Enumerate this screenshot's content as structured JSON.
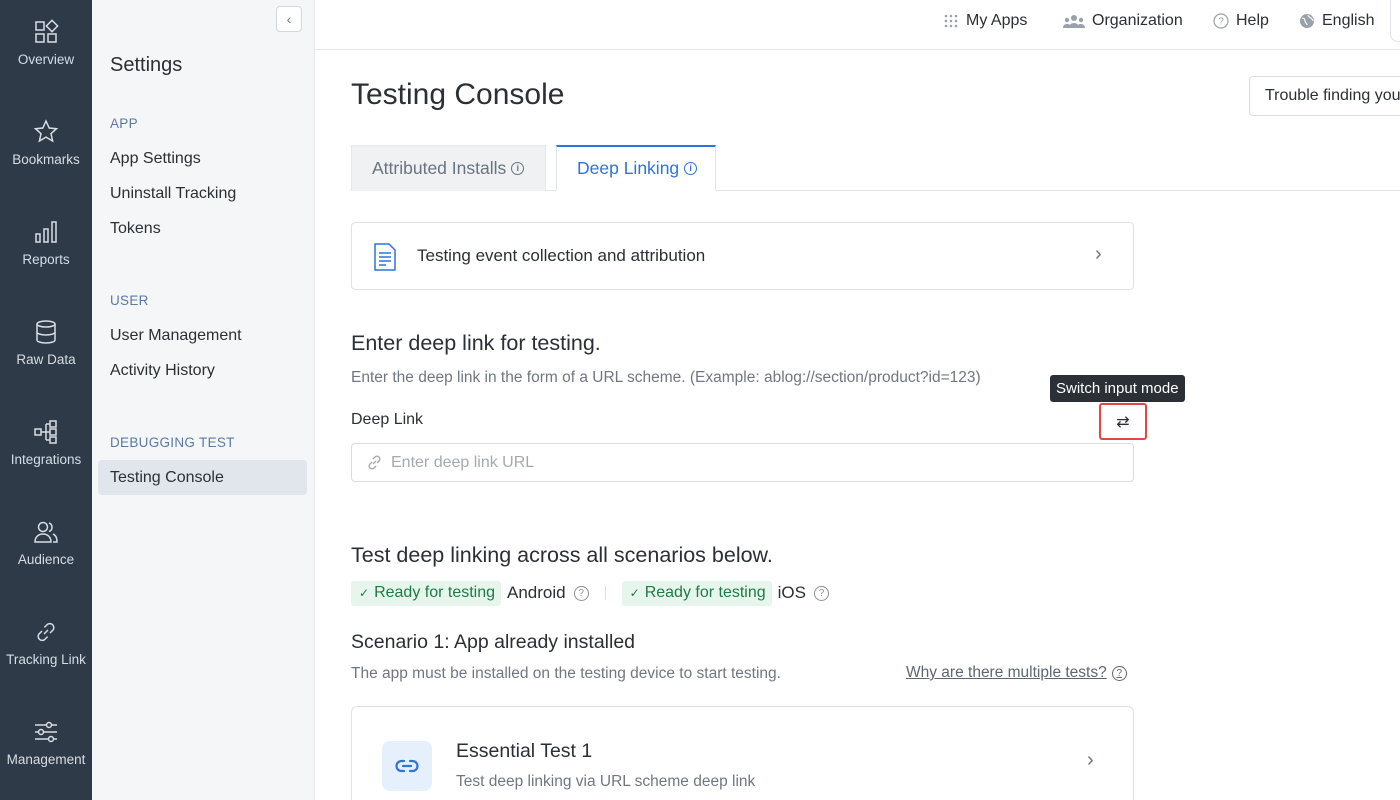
{
  "rail": {
    "items": [
      {
        "label": "Overview",
        "icon": "overview-grid-icon"
      },
      {
        "label": "Bookmarks",
        "icon": "star-icon"
      },
      {
        "label": "Reports",
        "icon": "bar-chart-icon"
      },
      {
        "label": "Raw Data",
        "icon": "database-icon"
      },
      {
        "label": "Integrations",
        "icon": "integration-tree-icon"
      },
      {
        "label": "Audience",
        "icon": "users-icon"
      },
      {
        "label": "Tracking Link",
        "icon": "link-icon"
      },
      {
        "label": "Management",
        "icon": "sliders-icon"
      }
    ]
  },
  "sidebar": {
    "collapse_glyph": "‹",
    "title": "Settings",
    "sections": [
      {
        "label": "APP",
        "items": [
          "App Settings",
          "Uninstall Tracking",
          "Tokens"
        ]
      },
      {
        "label": "USER",
        "items": [
          "User Management",
          "Activity History"
        ]
      },
      {
        "label": "DEBUGGING TEST",
        "items": [
          "Testing Console"
        ]
      }
    ],
    "active_item": "Testing Console"
  },
  "topbar": {
    "my_apps": "My Apps",
    "organization": "Organization",
    "help": "Help",
    "language": "English"
  },
  "main": {
    "title": "Testing Console",
    "trouble_button": "Trouble finding you",
    "tabs": [
      {
        "label": "Attributed Installs",
        "active": false
      },
      {
        "label": "Deep Linking",
        "active": true
      }
    ],
    "guide_card": "Testing event collection and attribution",
    "deep_link": {
      "heading": "Enter deep link for testing.",
      "description": "Enter the deep link in the form of a URL scheme. (Example: ablog://section/product?id=123)",
      "field_label": "Deep Link",
      "placeholder": "Enter deep link URL",
      "value": "",
      "tooltip": "Switch input mode",
      "switch_glyph": "⇄"
    },
    "scenarios": {
      "heading": "Test deep linking across all scenarios below.",
      "status": [
        {
          "badge": "Ready for testing",
          "platform": "Android"
        },
        {
          "badge": "Ready for testing",
          "platform": "iOS"
        }
      ],
      "scenario1_title": "Scenario 1: App already installed",
      "scenario1_desc": "The app must be installed on the testing device to start testing.",
      "why_link": "Why are there multiple tests?",
      "test1_title": "Essential Test 1",
      "test1_desc": "Test deep linking via URL scheme deep link"
    }
  },
  "colors": {
    "rail_bg": "#2e3a48",
    "accent": "#2f74d9",
    "ready_bg": "#e7f6ec",
    "ready_text": "#1f7a45",
    "highlight": "#e04848"
  }
}
